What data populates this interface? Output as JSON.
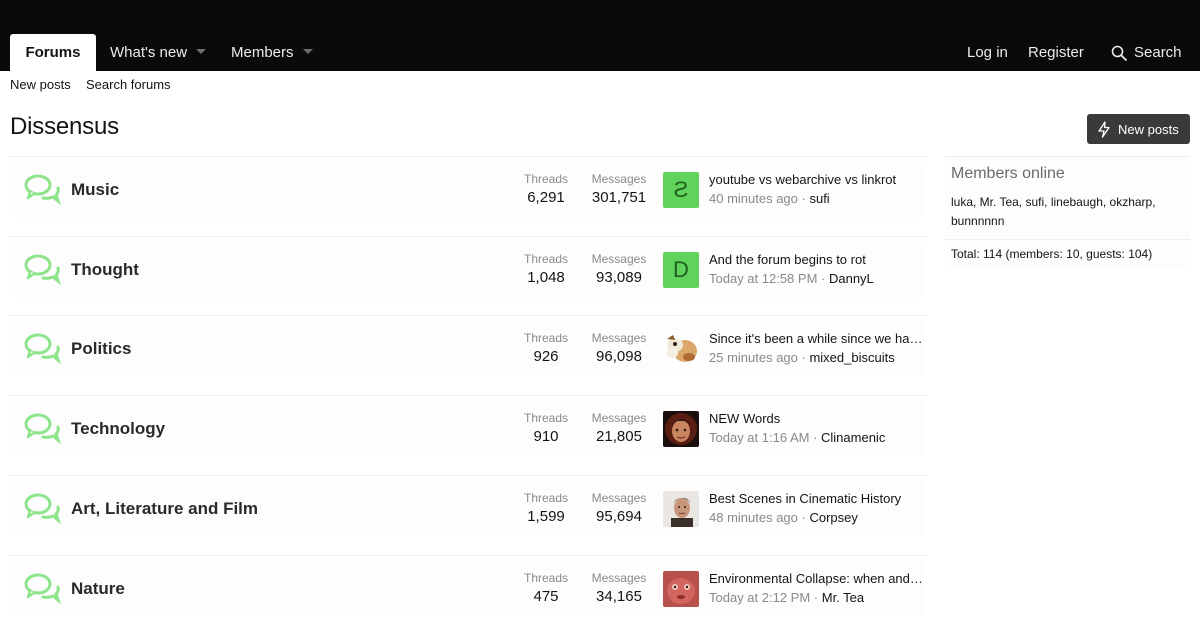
{
  "topnav": {
    "tabs": [
      {
        "label": "Forums"
      },
      {
        "label": "What's new"
      },
      {
        "label": "Members"
      }
    ],
    "login": "Log in",
    "register": "Register",
    "search": "Search"
  },
  "subnav": {
    "new_posts": "New posts",
    "search_forums": "Search forums"
  },
  "page": {
    "title": "Dissensus",
    "new_posts_button": "New posts"
  },
  "forums": [
    {
      "name": "Music",
      "threads_label": "Threads",
      "threads": "6,291",
      "messages_label": "Messages",
      "messages": "301,751",
      "latest_title": "youtube vs webarchive vs linkrot",
      "latest_time": "40 minutes ago",
      "latest_user": "sufi",
      "avatar_letter": "S",
      "avatar": "letter-s"
    },
    {
      "name": "Thought",
      "threads_label": "Threads",
      "threads": "1,048",
      "messages_label": "Messages",
      "messages": "93,089",
      "latest_title": "And the forum begins to rot",
      "latest_time": "Today at 12:58 PM",
      "latest_user": "DannyL",
      "avatar_letter": "D",
      "avatar": "letter-d"
    },
    {
      "name": "Politics",
      "threads_label": "Threads",
      "threads": "926",
      "messages_label": "Messages",
      "messages": "96,098",
      "latest_title": "Since it's been a while since we had …",
      "latest_time": "25 minutes ago",
      "latest_user": "mixed_biscuits",
      "avatar": "dog-photo"
    },
    {
      "name": "Technology",
      "threads_label": "Threads",
      "threads": "910",
      "messages_label": "Messages",
      "messages": "21,805",
      "latest_title": "NEW Words",
      "latest_time": "Today at 1:16 AM",
      "latest_user": "Clinamenic",
      "avatar": "face-photo"
    },
    {
      "name": "Art, Literature and Film",
      "threads_label": "Threads",
      "threads": "1,599",
      "messages_label": "Messages",
      "messages": "95,694",
      "latest_title": "Best Scenes in Cinematic History",
      "latest_time": "48 minutes ago",
      "latest_user": "Corpsey",
      "avatar": "portrait-photo"
    },
    {
      "name": "Nature",
      "threads_label": "Threads",
      "threads": "475",
      "messages_label": "Messages",
      "messages": "34,165",
      "latest_title": "Environmental Collapse: when and h…",
      "latest_time": "Today at 2:12 PM",
      "latest_user": "Mr. Tea",
      "avatar": "red-face-photo"
    }
  ],
  "sidebar": {
    "title": "Members online",
    "users": "luka, Mr. Tea, sufi, linebaugh, okzharp, bunnnnnn",
    "total": "Total: 114 (members: 10, guests: 104)"
  },
  "colors": {
    "topbar": "#0a0a0b",
    "forum_icon": "#8ee48a",
    "avatar_green": "#5fd35b",
    "button": "#3a3a3a"
  }
}
